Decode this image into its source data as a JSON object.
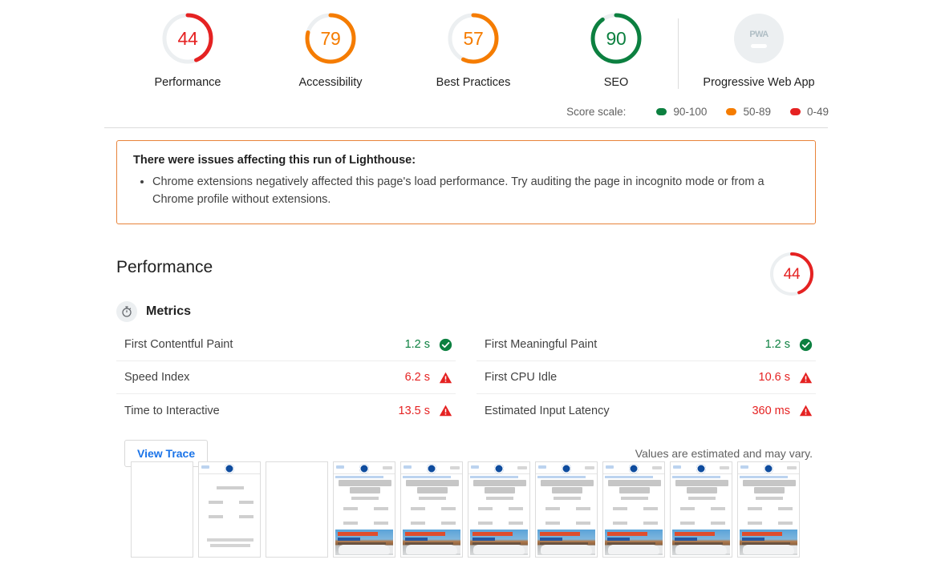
{
  "report": {
    "categories": [
      {
        "label": "Performance",
        "score": 44,
        "color": "#e52222",
        "type": "gauge"
      },
      {
        "label": "Accessibility",
        "score": 79,
        "color": "#f57c00",
        "type": "gauge"
      },
      {
        "label": "Best Practices",
        "score": 57,
        "color": "#f57c00",
        "type": "gauge"
      },
      {
        "label": "SEO",
        "score": 90,
        "color": "#0c8040",
        "type": "gauge"
      },
      {
        "label": "Progressive Web App",
        "badge": "PWA",
        "type": "badge"
      }
    ],
    "score_scale": {
      "label": "Score scale:",
      "items": [
        {
          "range": "90-100",
          "color": "#0c8040"
        },
        {
          "range": "50-89",
          "color": "#f57c00"
        },
        {
          "range": "0-49",
          "color": "#e52222"
        }
      ]
    },
    "warning": {
      "title": "There were issues affecting this run of Lighthouse:",
      "items": [
        "Chrome extensions negatively affected this page's load performance. Try auditing the page in incognito mode or from a Chrome profile without extensions."
      ],
      "border_color": "#e8833a"
    },
    "performance": {
      "title": "Performance",
      "score": 44,
      "score_color": "#e52222",
      "metrics_heading": "Metrics",
      "metrics_icon": "stopwatch-icon",
      "metrics": [
        {
          "name": "First Contentful Paint",
          "value": "1.2 s",
          "status": "pass",
          "icon": "check-circle-icon"
        },
        {
          "name": "Speed Index",
          "value": "6.2 s",
          "status": "fail",
          "icon": "warning-triangle-icon"
        },
        {
          "name": "Time to Interactive",
          "value": "13.5 s",
          "status": "fail",
          "icon": "warning-triangle-icon"
        },
        {
          "name": "First Meaningful Paint",
          "value": "1.2 s",
          "status": "pass",
          "icon": "check-circle-icon"
        },
        {
          "name": "First CPU Idle",
          "value": "10.6 s",
          "status": "fail",
          "icon": "warning-triangle-icon"
        },
        {
          "name": "Estimated Input Latency",
          "value": "360 ms",
          "status": "fail",
          "icon": "warning-triangle-icon"
        }
      ],
      "view_trace_label": "View Trace",
      "estimate_note": "Values are estimated and may vary."
    },
    "filmstrip": {
      "frames": [
        {
          "state": "blank"
        },
        {
          "state": "early"
        },
        {
          "state": "blank"
        },
        {
          "state": "loaded"
        },
        {
          "state": "loaded"
        },
        {
          "state": "loaded"
        },
        {
          "state": "loaded"
        },
        {
          "state": "loaded"
        },
        {
          "state": "loaded"
        },
        {
          "state": "loaded"
        }
      ]
    }
  }
}
